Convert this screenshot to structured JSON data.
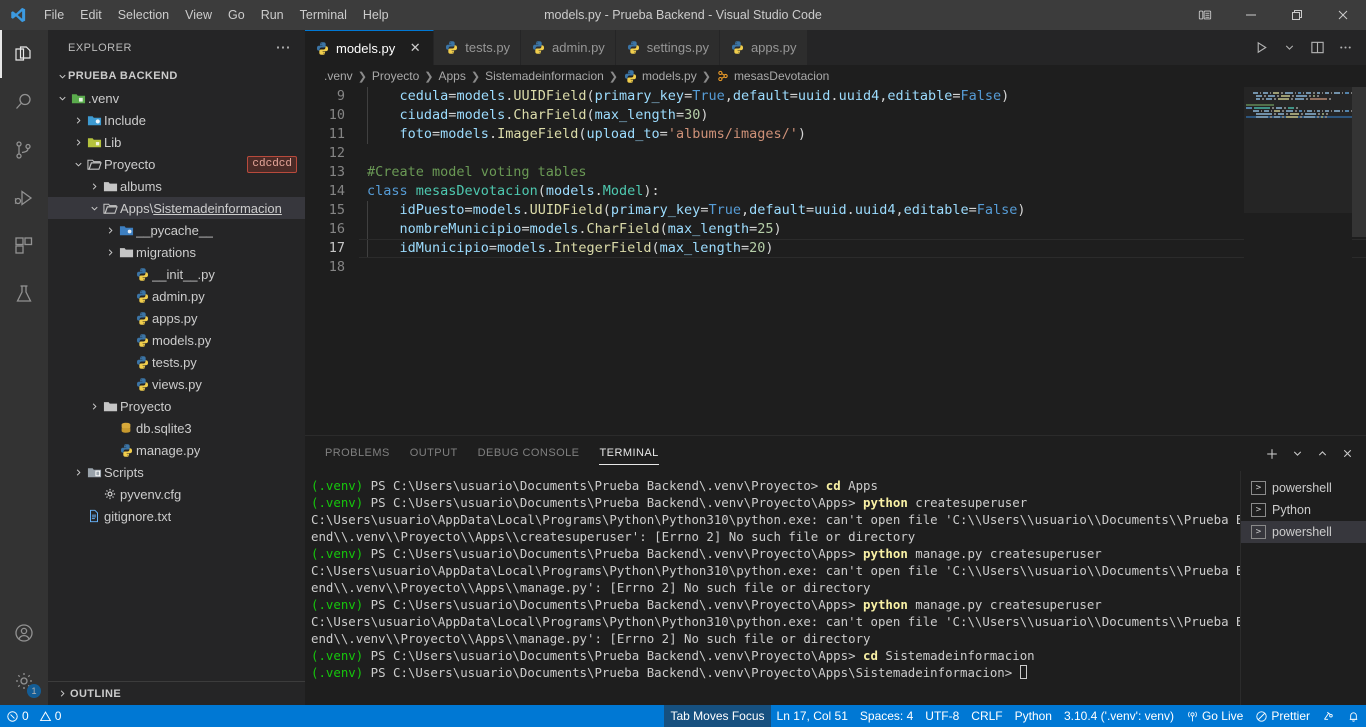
{
  "window": {
    "title": "models.py - Prueba Backend - Visual Studio Code",
    "logo_icon": "vscode-logo-icon",
    "menus": [
      "File",
      "Edit",
      "Selection",
      "View",
      "Go",
      "Run",
      "Terminal",
      "Help"
    ],
    "controls": {
      "layout_icon": "customize-layout-icon",
      "minimize_icon": "minimize-icon",
      "maximize_icon": "restore-icon",
      "close_icon": "close-icon"
    }
  },
  "activitybar": {
    "items": [
      {
        "name": "explorer",
        "icon": "files-icon",
        "active": true
      },
      {
        "name": "search",
        "icon": "search-icon",
        "active": false
      },
      {
        "name": "source-control",
        "icon": "source-control-icon",
        "active": false
      },
      {
        "name": "run-and-debug",
        "icon": "run-debug-icon",
        "active": false
      },
      {
        "name": "extensions",
        "icon": "extensions-icon",
        "active": false
      },
      {
        "name": "testing",
        "icon": "beaker-icon",
        "active": false
      }
    ],
    "bottom": [
      {
        "name": "accounts",
        "icon": "account-icon",
        "badge": ""
      },
      {
        "name": "manage",
        "icon": "gear-icon",
        "badge": "1"
      }
    ]
  },
  "sidebar": {
    "header": "EXPLORER",
    "more_actions_icon": "ellipsis-icon",
    "root": "PRUEBA BACKEND",
    "venv_badge": "cdcdcd",
    "outline_label": "OUTLINE",
    "tree": [
      {
        "label": ".venv",
        "depth": 1,
        "type": "folder",
        "icon": "folder-venv-icon",
        "state": "expanded",
        "selected": false
      },
      {
        "label": "Include",
        "depth": 2,
        "type": "folder",
        "icon": "folder-include-icon",
        "state": "collapsed",
        "selected": false
      },
      {
        "label": "Lib",
        "depth": 2,
        "type": "folder",
        "icon": "folder-lib-icon",
        "state": "collapsed",
        "selected": false
      },
      {
        "label": "Proyecto",
        "depth": 2,
        "type": "folder",
        "icon": "folder-open-icon",
        "state": "expanded",
        "selected": false
      },
      {
        "label": "albums",
        "depth": 3,
        "type": "folder",
        "icon": "folder-icon",
        "state": "collapsed",
        "selected": false
      },
      {
        "label": "Apps\\Sistemadeinformacion",
        "depth": 3,
        "type": "folder",
        "icon": "folder-open-icon",
        "state": "expanded",
        "selected": true,
        "underline_from": 5
      },
      {
        "label": "__pycache__",
        "depth": 4,
        "type": "folder",
        "icon": "folder-cache-icon",
        "state": "collapsed",
        "selected": false
      },
      {
        "label": "migrations",
        "depth": 4,
        "type": "folder",
        "icon": "folder-icon",
        "state": "collapsed",
        "selected": false
      },
      {
        "label": "__init__.py",
        "depth": 5,
        "type": "file",
        "icon": "python-icon",
        "state": "none",
        "selected": false
      },
      {
        "label": "admin.py",
        "depth": 5,
        "type": "file",
        "icon": "python-icon",
        "state": "none",
        "selected": false
      },
      {
        "label": "apps.py",
        "depth": 5,
        "type": "file",
        "icon": "python-icon",
        "state": "none",
        "selected": false
      },
      {
        "label": "models.py",
        "depth": 5,
        "type": "file",
        "icon": "python-icon",
        "state": "none",
        "selected": false
      },
      {
        "label": "tests.py",
        "depth": 5,
        "type": "file",
        "icon": "python-icon",
        "state": "none",
        "selected": false
      },
      {
        "label": "views.py",
        "depth": 5,
        "type": "file",
        "icon": "python-icon",
        "state": "none",
        "selected": false
      },
      {
        "label": "Proyecto",
        "depth": 3,
        "type": "folder",
        "icon": "folder-icon",
        "state": "collapsed",
        "selected": false
      },
      {
        "label": "db.sqlite3",
        "depth": 4,
        "type": "file",
        "icon": "database-icon",
        "state": "none",
        "selected": false
      },
      {
        "label": "manage.py",
        "depth": 4,
        "type": "file",
        "icon": "python-icon",
        "state": "none",
        "selected": false
      },
      {
        "label": "Scripts",
        "depth": 2,
        "type": "folder",
        "icon": "folder-scripts-icon",
        "state": "collapsed",
        "selected": false
      },
      {
        "label": "pyvenv.cfg",
        "depth": 3,
        "type": "file",
        "icon": "gear-file-icon",
        "state": "none",
        "selected": false
      },
      {
        "label": "gitignore.txt",
        "depth": 2,
        "type": "file",
        "icon": "text-file-icon",
        "state": "none",
        "selected": false
      }
    ]
  },
  "editor": {
    "tabs": [
      {
        "label": "models.py",
        "icon": "python-icon",
        "active": true,
        "close_icon": "close-icon"
      },
      {
        "label": "tests.py",
        "icon": "python-icon",
        "active": false
      },
      {
        "label": "admin.py",
        "icon": "python-icon",
        "active": false
      },
      {
        "label": "settings.py",
        "icon": "python-icon",
        "active": false
      },
      {
        "label": "apps.py",
        "icon": "python-icon",
        "active": false
      }
    ],
    "tab_actions": [
      {
        "name": "run-python-file",
        "icon": "play-icon"
      },
      {
        "name": "run-options",
        "icon": "chevron-down-icon"
      },
      {
        "name": "split-editor",
        "icon": "split-editor-icon"
      },
      {
        "name": "more-actions",
        "icon": "ellipsis-icon"
      }
    ],
    "breadcrumb": [
      {
        "label": ".venv",
        "icon": ""
      },
      {
        "label": "Proyecto",
        "icon": ""
      },
      {
        "label": "Apps",
        "icon": ""
      },
      {
        "label": "Sistemadeinformacion",
        "icon": ""
      },
      {
        "label": "models.py",
        "icon": "python-icon"
      },
      {
        "label": "mesasDevotacion",
        "icon": "class-icon"
      }
    ],
    "first_line_number": 9,
    "current_line": 17,
    "lines": [
      {
        "n": 9,
        "indent": 1,
        "tokens": [
          {
            "t": "cedula",
            "c": "t-var"
          },
          {
            "t": "=",
            "c": "t-op"
          },
          {
            "t": "models",
            "c": "t-var"
          },
          {
            "t": ".",
            "c": "t-op"
          },
          {
            "t": "UUIDField",
            "c": "t-fn"
          },
          {
            "t": "(",
            "c": "t-op"
          },
          {
            "t": "primary_key",
            "c": "t-var"
          },
          {
            "t": "=",
            "c": "t-op"
          },
          {
            "t": "True",
            "c": "t-kw"
          },
          {
            "t": ",",
            "c": "t-op"
          },
          {
            "t": "default",
            "c": "t-var"
          },
          {
            "t": "=",
            "c": "t-op"
          },
          {
            "t": "uuid",
            "c": "t-var"
          },
          {
            "t": ".",
            "c": "t-op"
          },
          {
            "t": "uuid4",
            "c": "t-var"
          },
          {
            "t": ",",
            "c": "t-op"
          },
          {
            "t": "editable",
            "c": "t-var"
          },
          {
            "t": "=",
            "c": "t-op"
          },
          {
            "t": "False",
            "c": "t-kw"
          },
          {
            "t": ")",
            "c": "t-op"
          }
        ]
      },
      {
        "n": 10,
        "indent": 1,
        "tokens": [
          {
            "t": "ciudad",
            "c": "t-var"
          },
          {
            "t": "=",
            "c": "t-op"
          },
          {
            "t": "models",
            "c": "t-var"
          },
          {
            "t": ".",
            "c": "t-op"
          },
          {
            "t": "CharField",
            "c": "t-fn"
          },
          {
            "t": "(",
            "c": "t-op"
          },
          {
            "t": "max_length",
            "c": "t-var"
          },
          {
            "t": "=",
            "c": "t-op"
          },
          {
            "t": "30",
            "c": "t-num"
          },
          {
            "t": ")",
            "c": "t-op"
          }
        ]
      },
      {
        "n": 11,
        "indent": 1,
        "tokens": [
          {
            "t": "foto",
            "c": "t-var"
          },
          {
            "t": "=",
            "c": "t-op"
          },
          {
            "t": "models",
            "c": "t-var"
          },
          {
            "t": ".",
            "c": "t-op"
          },
          {
            "t": "ImageField",
            "c": "t-fn"
          },
          {
            "t": "(",
            "c": "t-op"
          },
          {
            "t": "upload_to",
            "c": "t-var"
          },
          {
            "t": "=",
            "c": "t-op"
          },
          {
            "t": "'albums/images/'",
            "c": "t-str"
          },
          {
            "t": ")",
            "c": "t-op"
          }
        ]
      },
      {
        "n": 12,
        "indent": 0,
        "tokens": []
      },
      {
        "n": 13,
        "indent": 0,
        "tokens": [
          {
            "t": "#Create model voting tables",
            "c": "t-cmt"
          }
        ]
      },
      {
        "n": 14,
        "indent": 0,
        "tokens": [
          {
            "t": "class ",
            "c": "t-kw"
          },
          {
            "t": "mesasDevotacion",
            "c": "t-cls"
          },
          {
            "t": "(",
            "c": "t-op"
          },
          {
            "t": "models",
            "c": "t-var"
          },
          {
            "t": ".",
            "c": "t-op"
          },
          {
            "t": "Model",
            "c": "t-cls"
          },
          {
            "t": "):",
            "c": "t-op"
          }
        ]
      },
      {
        "n": 15,
        "indent": 1,
        "tokens": [
          {
            "t": "idPuesto",
            "c": "t-var"
          },
          {
            "t": "=",
            "c": "t-op"
          },
          {
            "t": "models",
            "c": "t-var"
          },
          {
            "t": ".",
            "c": "t-op"
          },
          {
            "t": "UUIDField",
            "c": "t-fn"
          },
          {
            "t": "(",
            "c": "t-op"
          },
          {
            "t": "primary_key",
            "c": "t-var"
          },
          {
            "t": "=",
            "c": "t-op"
          },
          {
            "t": "True",
            "c": "t-kw"
          },
          {
            "t": ",",
            "c": "t-op"
          },
          {
            "t": "default",
            "c": "t-var"
          },
          {
            "t": "=",
            "c": "t-op"
          },
          {
            "t": "uuid",
            "c": "t-var"
          },
          {
            "t": ".",
            "c": "t-op"
          },
          {
            "t": "uuid4",
            "c": "t-var"
          },
          {
            "t": ",",
            "c": "t-op"
          },
          {
            "t": "editable",
            "c": "t-var"
          },
          {
            "t": "=",
            "c": "t-op"
          },
          {
            "t": "False",
            "c": "t-kw"
          },
          {
            "t": ")",
            "c": "t-op"
          }
        ]
      },
      {
        "n": 16,
        "indent": 1,
        "tokens": [
          {
            "t": "nombreMunicipio",
            "c": "t-var"
          },
          {
            "t": "=",
            "c": "t-op"
          },
          {
            "t": "models",
            "c": "t-var"
          },
          {
            "t": ".",
            "c": "t-op"
          },
          {
            "t": "CharField",
            "c": "t-fn"
          },
          {
            "t": "(",
            "c": "t-op"
          },
          {
            "t": "max_length",
            "c": "t-var"
          },
          {
            "t": "=",
            "c": "t-op"
          },
          {
            "t": "25",
            "c": "t-num"
          },
          {
            "t": ")",
            "c": "t-op"
          }
        ]
      },
      {
        "n": 17,
        "indent": 1,
        "tokens": [
          {
            "t": "idMunicipio",
            "c": "t-var"
          },
          {
            "t": "=",
            "c": "t-op"
          },
          {
            "t": "models",
            "c": "t-var"
          },
          {
            "t": ".",
            "c": "t-op"
          },
          {
            "t": "IntegerField",
            "c": "t-fn"
          },
          {
            "t": "(",
            "c": "t-op"
          },
          {
            "t": "max_length",
            "c": "t-var"
          },
          {
            "t": "=",
            "c": "t-op"
          },
          {
            "t": "20",
            "c": "t-num"
          },
          {
            "t": ")",
            "c": "t-op"
          }
        ]
      },
      {
        "n": 18,
        "indent": 0,
        "tokens": []
      }
    ]
  },
  "panel": {
    "tabs": [
      {
        "label": "PROBLEMS",
        "active": false
      },
      {
        "label": "OUTPUT",
        "active": false
      },
      {
        "label": "DEBUG CONSOLE",
        "active": false
      },
      {
        "label": "TERMINAL",
        "active": true
      }
    ],
    "actions": [
      {
        "name": "new-terminal",
        "icon": "plus-icon"
      },
      {
        "name": "terminal-options",
        "icon": "chevron-down-icon"
      },
      {
        "name": "maximize-panel",
        "icon": "chevron-up-icon"
      },
      {
        "name": "close-panel",
        "icon": "close-icon"
      }
    ],
    "terminal_list": [
      {
        "label": "powershell",
        "icon": "terminal-icon",
        "active": false
      },
      {
        "label": "Python",
        "icon": "terminal-icon",
        "active": false
      },
      {
        "label": "powershell",
        "icon": "terminal-icon",
        "active": true
      }
    ],
    "terminal_lines": [
      [
        {
          "t": "(.venv)",
          "c": "g"
        },
        {
          "t": " PS C:\\Users\\usuario\\Documents\\Prueba Backend\\.venv\\Proyecto> ",
          "c": "w"
        },
        {
          "t": "cd",
          "c": "y"
        },
        {
          "t": " Apps",
          "c": "w"
        }
      ],
      [
        {
          "t": "(.venv)",
          "c": "g"
        },
        {
          "t": " PS C:\\Users\\usuario\\Documents\\Prueba Backend\\.venv\\Proyecto\\Apps> ",
          "c": "w"
        },
        {
          "t": "python",
          "c": "y"
        },
        {
          "t": " createsuperuser",
          "c": "w"
        }
      ],
      [
        {
          "t": "C:\\Users\\usuario\\AppData\\Local\\Programs\\Python\\Python310\\python.exe: can't open file 'C:\\\\Users\\\\usuario\\\\Documents\\\\Prueba Back",
          "c": "w"
        }
      ],
      [
        {
          "t": "end\\\\.venv\\\\Proyecto\\\\Apps\\\\createsuperuser': [Errno 2] No such file or directory",
          "c": "w"
        }
      ],
      [
        {
          "t": "(.venv)",
          "c": "g"
        },
        {
          "t": " PS C:\\Users\\usuario\\Documents\\Prueba Backend\\.venv\\Proyecto\\Apps> ",
          "c": "w"
        },
        {
          "t": "python",
          "c": "y"
        },
        {
          "t": " manage.py createsuperuser",
          "c": "w"
        }
      ],
      [
        {
          "t": "C:\\Users\\usuario\\AppData\\Local\\Programs\\Python\\Python310\\python.exe: can't open file 'C:\\\\Users\\\\usuario\\\\Documents\\\\Prueba Back",
          "c": "w"
        }
      ],
      [
        {
          "t": "end\\\\.venv\\\\Proyecto\\\\Apps\\\\manage.py': [Errno 2] No such file or directory",
          "c": "w"
        }
      ],
      [
        {
          "t": "(.venv)",
          "c": "g"
        },
        {
          "t": " PS C:\\Users\\usuario\\Documents\\Prueba Backend\\.venv\\Proyecto\\Apps> ",
          "c": "w"
        },
        {
          "t": "python",
          "c": "y"
        },
        {
          "t": " manage.py createsuperuser",
          "c": "w"
        }
      ],
      [
        {
          "t": "C:\\Users\\usuario\\AppData\\Local\\Programs\\Python\\Python310\\python.exe: can't open file 'C:\\\\Users\\\\usuario\\\\Documents\\\\Prueba Back",
          "c": "w"
        }
      ],
      [
        {
          "t": "end\\\\.venv\\\\Proyecto\\\\Apps\\\\manage.py': [Errno 2] No such file or directory",
          "c": "w"
        }
      ],
      [
        {
          "t": "(.venv)",
          "c": "g"
        },
        {
          "t": " PS C:\\Users\\usuario\\Documents\\Prueba Backend\\.venv\\Proyecto\\Apps> ",
          "c": "w"
        },
        {
          "t": "cd",
          "c": "y"
        },
        {
          "t": " Sistemadeinformacion",
          "c": "w"
        }
      ],
      [
        {
          "t": "(.venv)",
          "c": "g"
        },
        {
          "t": " PS C:\\Users\\usuario\\Documents\\Prueba Backend\\.venv\\Proyecto\\Apps\\Sistemadeinformacion> ",
          "c": "w"
        },
        {
          "t": "",
          "c": "cursor"
        }
      ]
    ]
  },
  "statusbar": {
    "left": [
      {
        "name": "problems",
        "icon": "error-icon",
        "label": "0",
        "icon2": "warning-icon",
        "label2": "0"
      }
    ],
    "right": [
      {
        "name": "tab-moves-focus",
        "label": "Tab Moves Focus",
        "prominent": true
      },
      {
        "name": "editor-position",
        "label": "Ln 17, Col 51"
      },
      {
        "name": "editor-indentation",
        "label": "Spaces: 4"
      },
      {
        "name": "editor-encoding",
        "label": "UTF-8"
      },
      {
        "name": "editor-eol",
        "label": "CRLF"
      },
      {
        "name": "editor-language",
        "label": "Python"
      },
      {
        "name": "python-interpreter",
        "label": "3.10.4 ('.venv': venv)"
      },
      {
        "name": "go-live",
        "label": "Go Live",
        "icon": "broadcast-icon"
      },
      {
        "name": "prettier",
        "label": "Prettier",
        "icon": "prohibited-icon"
      },
      {
        "name": "remote-host",
        "label": "",
        "icon": "remote-icon"
      },
      {
        "name": "notifications",
        "label": "",
        "icon": "bell-icon"
      }
    ]
  },
  "colors": {
    "accent": "#0078d4",
    "titlebar_bg": "#3c3c3c",
    "sidebar_bg": "#252526",
    "editor_bg": "#1e1e1e",
    "activitybar_bg": "#333333"
  }
}
